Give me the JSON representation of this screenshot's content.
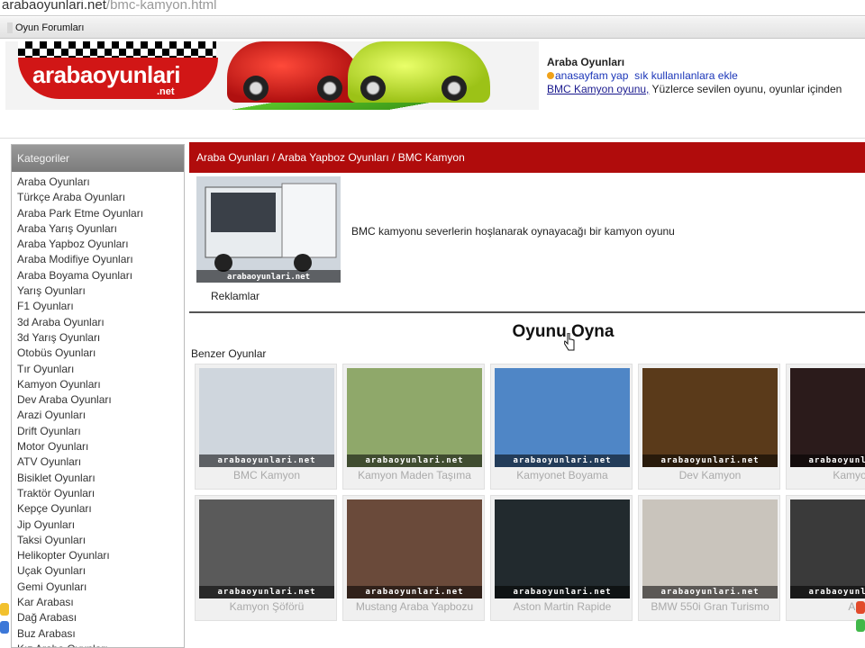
{
  "browser": {
    "url_host": "arabaoyunlari.net",
    "url_path": "/bmc-kamyon.html",
    "bookmark": "Oyun Forumları"
  },
  "header": {
    "logo_text": "arabaoyunlari",
    "logo_sub": ".net",
    "info_title": "Araba Oyunları",
    "home_link": "anasayfam yap",
    "fav_link": "sık kullanılanlara ekle",
    "game_link": "BMC Kamyon oyunu,",
    "game_blurb": " Yüzlerce sevilen oyunu, oyunlar içinden"
  },
  "sidebar": {
    "title": "Kategoriler",
    "items": [
      "Araba Oyunları",
      "Türkçe Araba Oyunları",
      "Araba Park Etme Oyunları",
      "Araba Yarış Oyunları",
      "Araba Yapboz Oyunları",
      "Araba Modifiye Oyunları",
      "Araba Boyama Oyunları",
      "Yarış Oyunları",
      "F1 Oyunları",
      "3d Araba Oyunları",
      "3d Yarış Oyunları",
      "Otobüs Oyunları",
      "Tır Oyunları",
      "Kamyon Oyunları",
      "Dev Araba Oyunları",
      "Arazi Oyunları",
      "Drift Oyunları",
      "Motor Oyunları",
      "ATV Oyunları",
      "Bisiklet Oyunları",
      "Traktör Oyunları",
      "Kepçe Oyunları",
      "Jip Oyunları",
      "Taksi Oyunları",
      "Helikopter Oyunları",
      "Uçak Oyunları",
      "Gemi Oyunları",
      "Kar Arabası",
      "Dağ Arabası",
      "Buz Arabası",
      "Kız Araba Oyunları"
    ]
  },
  "main": {
    "breadcrumb": [
      "Araba Oyunları",
      "Araba Yapboz Oyunları",
      "BMC Kamyon"
    ],
    "breadcrumb_sep": " / ",
    "description": "BMC kamyonu severlerin hoşlanarak oynayacağı bir kamyon oyunu",
    "ads_label": "Reklamlar",
    "play_label": "Oyunu Oyna",
    "similar_title": "Benzer Oyunlar",
    "watermark": "arabaoyunlari.net"
  },
  "games": [
    {
      "title": "BMC Kamyon",
      "color": "#cfd6dd"
    },
    {
      "title": "Kamyon Maden Taşıma",
      "color": "#8fa86a"
    },
    {
      "title": "Kamyonet Boyama",
      "color": "#4f86c6"
    },
    {
      "title": "Dev Kamyon",
      "color": "#5a3a1a"
    },
    {
      "title": "Kamyon S",
      "color": "#2b1b1b"
    },
    {
      "title": "Kamyon Şöförü",
      "color": "#5a5a5a"
    },
    {
      "title": "Mustang Araba Yapbozu",
      "color": "#6a4a3a"
    },
    {
      "title": "Aston Martin Rapide",
      "color": "#222a2e"
    },
    {
      "title": "BMW 550i Gran Turismo",
      "color": "#c9c4bc"
    },
    {
      "title": "Aud",
      "color": "#3a3a3a"
    }
  ]
}
